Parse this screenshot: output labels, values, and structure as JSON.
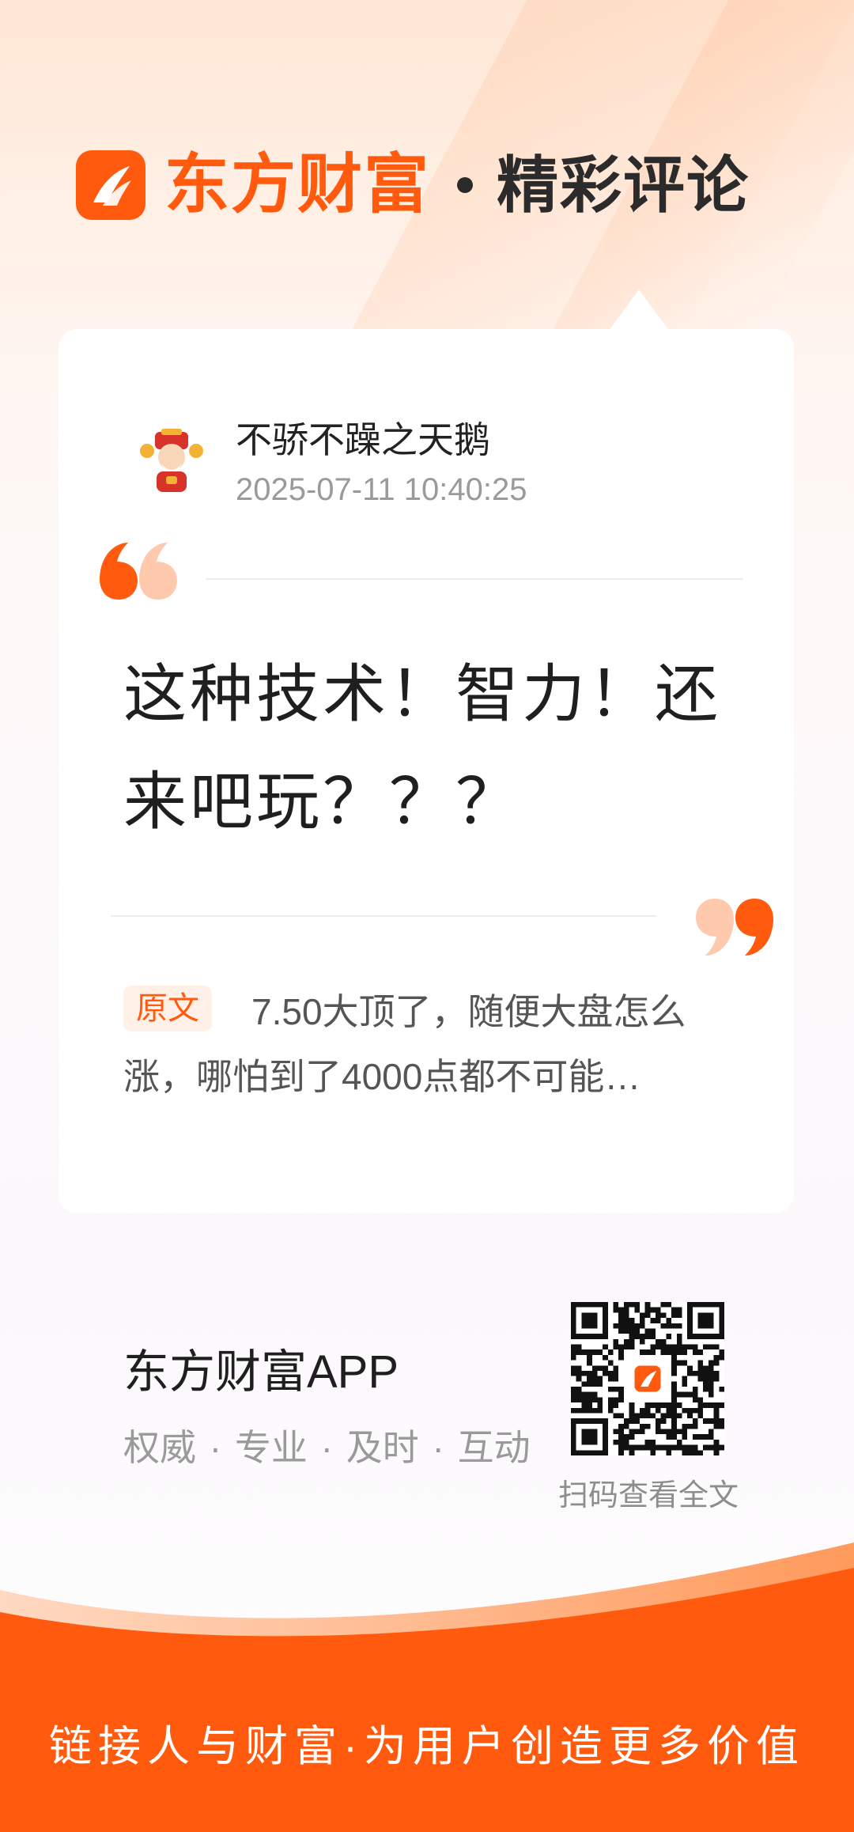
{
  "header": {
    "brand": "东方财富",
    "separator": "•",
    "subtitle": "精彩评论",
    "logo_icon": "eastmoney-logo-icon"
  },
  "comment_card": {
    "username": "不骄不躁之天鹅",
    "timestamp": "2025-07-11 10:40:25",
    "avatar_icon": "fortune-god-avatar",
    "comment_text": "这种技术！智力！还来吧玩？？？",
    "original_label": "原文",
    "original_text": "7.50大顶了，随便大盘怎么涨，哪怕到了4000点都不可能…"
  },
  "footer": {
    "app_name": "东方财富APP",
    "tagline": "权威 · 专业 · 及时 · 互动",
    "qr_caption": "扫码查看全文",
    "slogan": "链接人与财富·为用户创造更多价值"
  },
  "colors": {
    "brand_orange": "#ff5a0e",
    "text_dark": "#1f1f1f",
    "text_muted": "#9a9a9a"
  }
}
